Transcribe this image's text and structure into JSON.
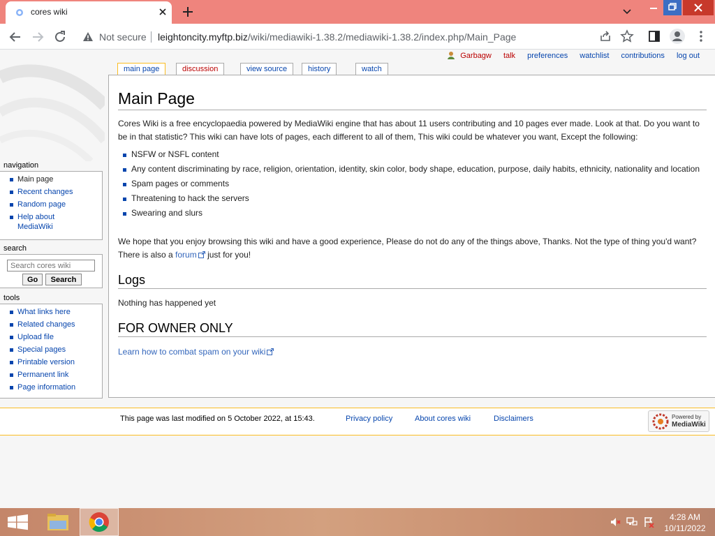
{
  "browser": {
    "tab_title": "cores wiki",
    "security_label": "Not secure",
    "url_host": "leightoncity.myftp.biz",
    "url_path": "/wiki/mediawiki-1.38.2/mediawiki-1.38.2/index.php/Main_Page"
  },
  "personal_tools": {
    "username": "Garbagw",
    "talk": "talk",
    "preferences": "preferences",
    "watchlist": "watchlist",
    "contributions": "contributions",
    "logout": "log out"
  },
  "page_tabs": [
    "main page",
    "discussion",
    "view source",
    "history",
    "watch"
  ],
  "article": {
    "title": "Main Page",
    "intro": "Cores Wiki is a free encyclopaedia powered by MediaWiki engine that has about 11 users contributing and 10 pages ever made. Look at that. Do you want to be in that statistic? This wiki can have lots of pages, each different to all of them, This wiki could be whatever you want, Except the following:",
    "rules": [
      "NSFW or NSFL content",
      "Any content discriminating by race, religion, orientation, identity, skin color, body shape, education, purpose, daily habits, ethnicity, nationality and location",
      "Spam pages or comments",
      "Threatening to hack the servers",
      "Swearing and slurs"
    ],
    "outro_before": "We hope that you enjoy browsing this wiki and have a good experience, Please do not do any of the things above, Thanks. Not the type of thing you'd want? There is also a ",
    "outro_link": "forum",
    "outro_after": " just for you!",
    "logs_heading": "Logs",
    "logs_text": "Nothing has happened yet",
    "owner_heading": "FOR OWNER ONLY",
    "owner_link": "Learn how to combat spam on your wiki"
  },
  "sidebar": {
    "navigation_heading": "navigation",
    "navigation": [
      "Main page",
      "Recent changes",
      "Random page",
      "Help about",
      "MediaWiki"
    ],
    "search_heading": "search",
    "search_placeholder": "Search cores wiki",
    "go_label": "Go",
    "search_label": "Search",
    "tools_heading": "tools",
    "tools": [
      "What links here",
      "Related changes",
      "Upload file",
      "Special pages",
      "Printable version",
      "Permanent link",
      "Page information"
    ]
  },
  "footer": {
    "last_modified": "This page was last modified on 5 October 2022, at 15:43.",
    "privacy": "Privacy policy",
    "about": "About cores wiki",
    "disclaimers": "Disclaimers",
    "powered_top": "Powered by",
    "powered_main": "MediaWiki"
  },
  "taskbar": {
    "time": "4:28 AM",
    "date": "10/11/2022"
  },
  "colors": {
    "titlebar": "#ef847d",
    "link": "#0645ad",
    "selected_tab_border": "#fabd23",
    "new_link": "#ba0000"
  }
}
